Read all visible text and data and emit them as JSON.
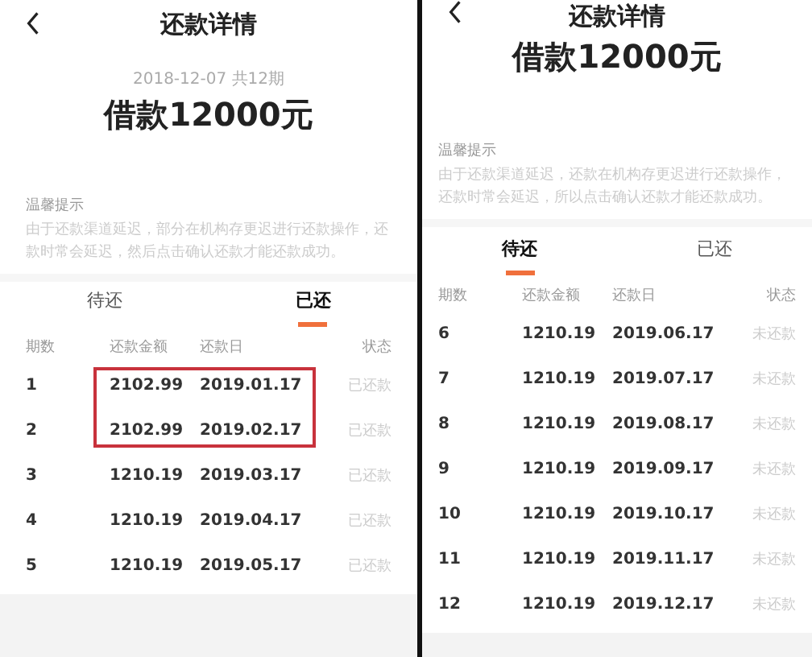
{
  "screens": [
    {
      "title": "还款详情",
      "date": "2018-12-07 共12期",
      "loan": "借款12000元",
      "notice_title": "温馨提示",
      "notice_text": "由于还款渠道延迟，部分在机构存更迟进行还款操作，还款时常会延迟，然后点击确认还款才能还款成功。",
      "tabs": [
        {
          "label": "待还",
          "selected": false
        },
        {
          "label": "已还",
          "selected": true
        }
      ],
      "columns": [
        "期数",
        "还款金额",
        "还款日",
        "状态"
      ],
      "rows": [
        {
          "period": "1",
          "amount": "2102.99",
          "date": "2019.01.17",
          "status": "已还款",
          "highlighted": true
        },
        {
          "period": "2",
          "amount": "2102.99",
          "date": "2019.02.17",
          "status": "已还款",
          "highlighted": true
        },
        {
          "period": "3",
          "amount": "1210.19",
          "date": "2019.03.17",
          "status": "已还款",
          "highlighted": false
        },
        {
          "period": "4",
          "amount": "1210.19",
          "date": "2019.04.17",
          "status": "已还款",
          "highlighted": false
        },
        {
          "period": "5",
          "amount": "1210.19",
          "date": "2019.05.17",
          "status": "已还款",
          "highlighted": false
        }
      ]
    },
    {
      "title": "还款详情",
      "loan": "借款12000元",
      "notice_title": "温馨提示",
      "notice_text": "由于还款渠道延迟，还款在机构存更迟进行还款操作，还款时常会延迟，所以点击确认还款才能还款成功。",
      "tabs": [
        {
          "label": "待还",
          "selected": true
        },
        {
          "label": "已还",
          "selected": false
        }
      ],
      "columns": [
        "期数",
        "还款金额",
        "还款日",
        "状态"
      ],
      "rows": [
        {
          "period": "6",
          "amount": "1210.19",
          "date": "2019.06.17",
          "status": "未还款",
          "highlighted": false
        },
        {
          "period": "7",
          "amount": "1210.19",
          "date": "2019.07.17",
          "status": "未还款",
          "highlighted": false
        },
        {
          "period": "8",
          "amount": "1210.19",
          "date": "2019.08.17",
          "status": "未还款",
          "highlighted": false
        },
        {
          "period": "9",
          "amount": "1210.19",
          "date": "2019.09.17",
          "status": "未还款",
          "highlighted": false
        },
        {
          "period": "10",
          "amount": "1210.19",
          "date": "2019.10.17",
          "status": "未还款",
          "highlighted": false
        },
        {
          "period": "11",
          "amount": "1210.19",
          "date": "2019.11.17",
          "status": "未还款",
          "highlighted": false
        },
        {
          "period": "12",
          "amount": "1210.19",
          "date": "2019.12.17",
          "status": "未还款",
          "highlighted": false
        }
      ]
    }
  ]
}
